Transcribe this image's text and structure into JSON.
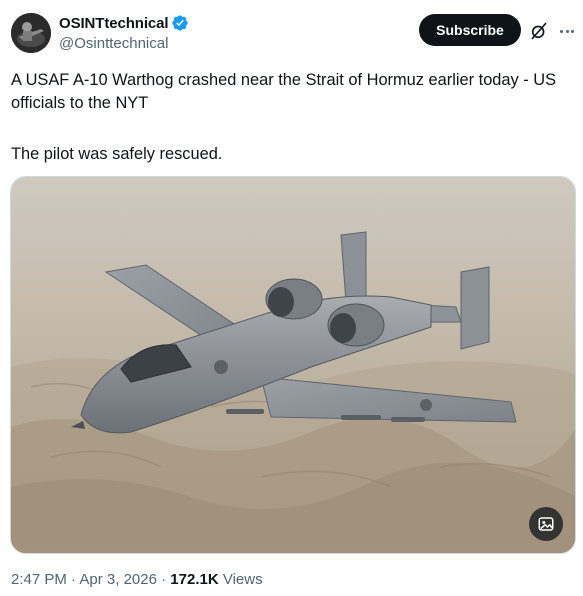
{
  "author": {
    "display_name": "OSINTtechnical",
    "handle": "@Osinttechnical",
    "verified": true
  },
  "actions": {
    "subscribe_label": "Subscribe",
    "grok_icon": "grok-icon",
    "more_icon": "more-icon"
  },
  "tweet": {
    "line1": "A USAF A-10 Warthog crashed near the Strait of Hormuz earlier today - US officials to the NYT",
    "line2": "The pilot was safely rescued."
  },
  "media": {
    "image_icon": "photo-icon"
  },
  "meta": {
    "time": "2:47 PM",
    "separator": "·",
    "date": "Apr 3, 2026",
    "views_count": "172.1K",
    "views_label": "Views"
  },
  "colors": {
    "primary_text": "#0f1419",
    "secondary_text": "#536471",
    "verified_blue": "#1d9bf0",
    "button_bg": "#0f1419"
  }
}
